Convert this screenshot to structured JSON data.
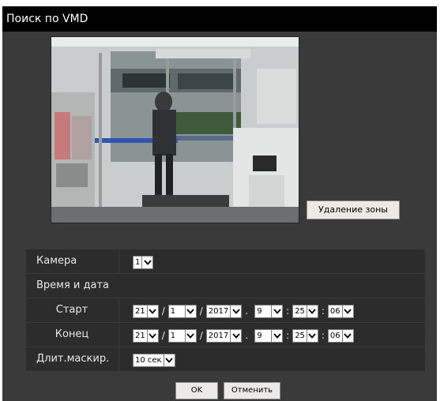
{
  "dialog": {
    "title": "Поиск по VMD"
  },
  "camera_view": {
    "description_icon": "camera-snapshot"
  },
  "buttons": {
    "delete_zone": "Удаление зоны",
    "ok": "OK",
    "cancel": "Отменить"
  },
  "form": {
    "camera": {
      "label": "Камера",
      "value": "1"
    },
    "datetime": {
      "label": "Время и дата"
    },
    "start": {
      "label": "Старт",
      "day": "21",
      "month": "1",
      "year": "2017",
      "hour": "9",
      "minute": "25",
      "second": "06"
    },
    "end": {
      "label": "Конец",
      "day": "21",
      "month": "1",
      "year": "2017",
      "hour": "9",
      "minute": "25",
      "second": "06"
    },
    "mask_duration": {
      "label": "Длит.маскир.",
      "value": "10 сек"
    },
    "separators": {
      "date": "/",
      "datetime": ".",
      "time": ":"
    }
  },
  "colors": {
    "dialog_bg": "#3a3a3a",
    "titlebar_bg": "#000000",
    "row_bg": "#2c2c2c"
  }
}
